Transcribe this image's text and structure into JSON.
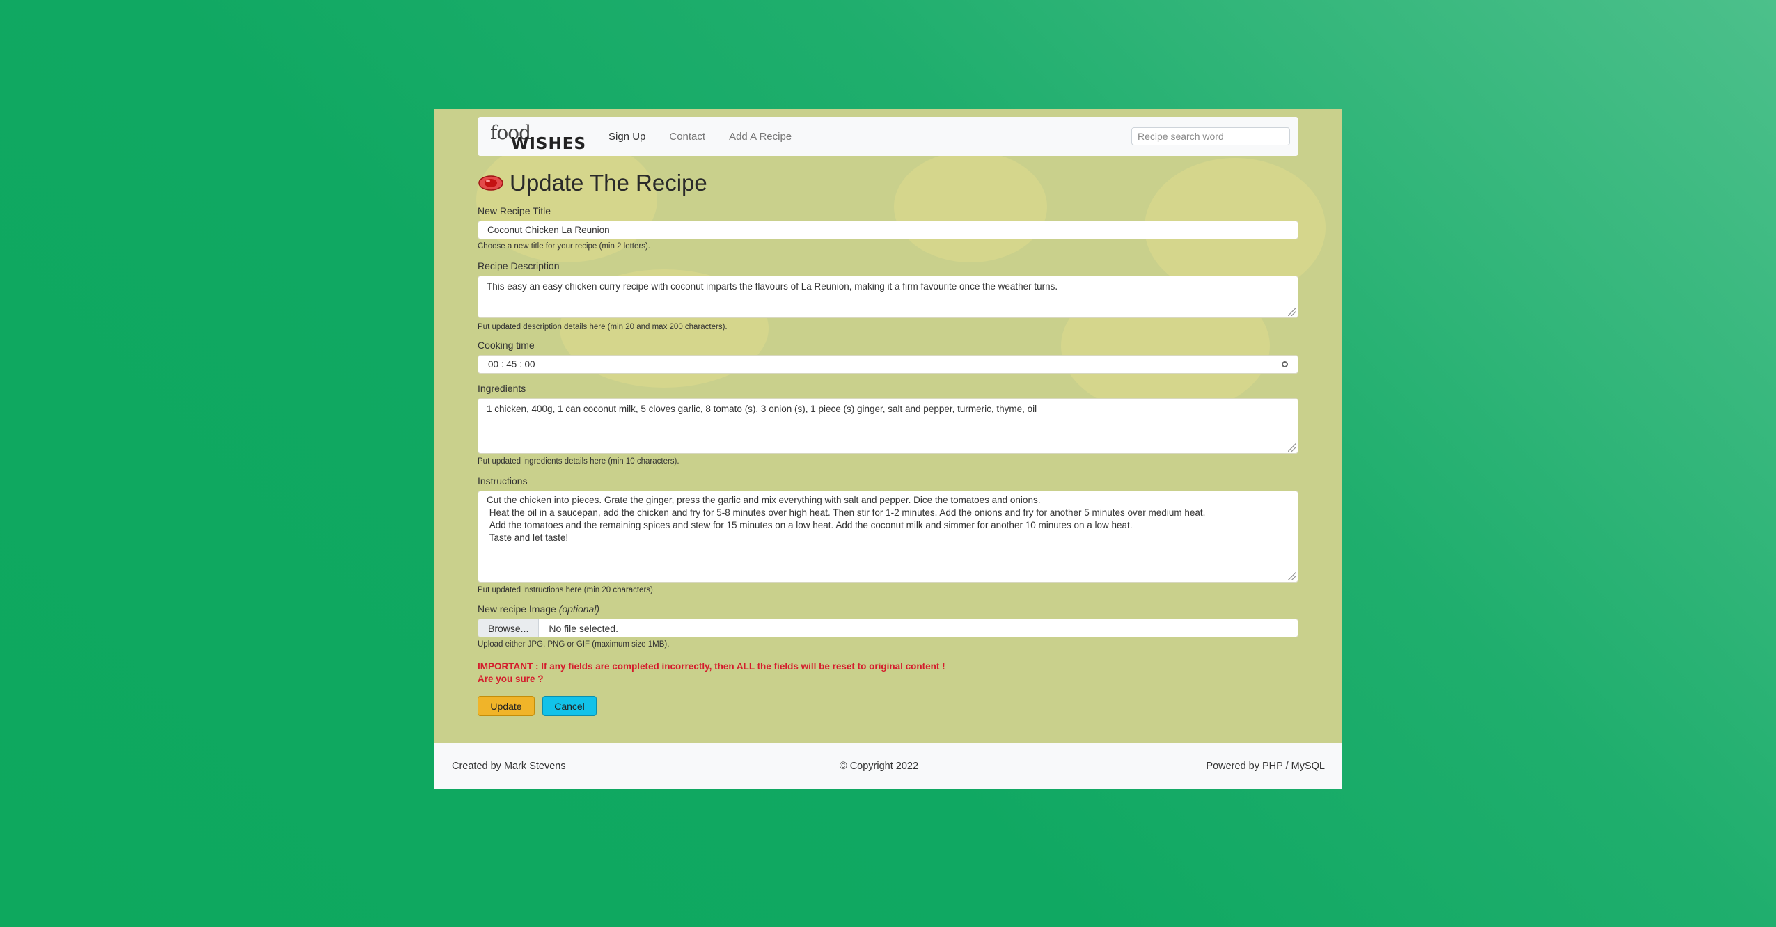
{
  "nav": {
    "logo_top": "food",
    "logo_bottom": "WISHES",
    "links": [
      "Sign Up",
      "Contact",
      "Add A Recipe"
    ],
    "search_placeholder": "Recipe search word"
  },
  "page": {
    "title": "Update The Recipe"
  },
  "form": {
    "title_label": "New Recipe Title",
    "title_value": "Coconut Chicken La Reunion",
    "title_hint": "Choose a new title for your recipe (min 2 letters).",
    "description_label": "Recipe Description",
    "description_value": "This easy an easy chicken curry recipe with coconut imparts the flavours of La Reunion, making it a firm favourite once the weather turns.",
    "description_hint": "Put updated description details here (min 20 and max 200 characters).",
    "cooking_time_label": "Cooking time",
    "cooking_time_value": "00 : 45 : 00",
    "ingredients_label": "Ingredients",
    "ingredients_value": "1 chicken, 400g, 1 can coconut milk, 5 cloves garlic, 8 tomato (s), 3 onion (s), 1 piece (s) ginger, salt and pepper, turmeric, thyme, oil",
    "ingredients_hint": "Put updated ingredients details here (min 10 characters).",
    "instructions_label": "Instructions",
    "instructions_value": "Cut the chicken into pieces. Grate the ginger, press the garlic and mix everything with salt and pepper. Dice the tomatoes and onions.\n Heat the oil in a saucepan, add the chicken and fry for 5-8 minutes over high heat. Then stir for 1-2 minutes. Add the onions and fry for another 5 minutes over medium heat.\n Add the tomatoes and the remaining spices and stew for 15 minutes on a low heat. Add the coconut milk and simmer for another 10 minutes on a low heat.\n Taste and let taste!",
    "instructions_hint": "Put updated instructions here (min 20 characters).",
    "image_label": "New recipe Image ",
    "image_label_optional": "(optional)",
    "browse_label": "Browse...",
    "file_status": "No file selected.",
    "image_hint": "Upload either JPG, PNG or GIF (maximum size 1MB).",
    "warning_line1": "IMPORTANT : If any fields are completed incorrectly, then ALL the fields will be reset to original content !",
    "warning_line2": "Are you sure ?",
    "update_button": "Update",
    "cancel_button": "Cancel"
  },
  "footer": {
    "left": "Created by Mark Stevens",
    "center": "© Copyright 2022",
    "right": "Powered by PHP / MySQL"
  },
  "colors": {
    "background": "#10a862",
    "panel": "#c9d08c",
    "warning": "#d41c2c",
    "update_button": "#f0b429",
    "cancel_button": "#12c2e9"
  }
}
